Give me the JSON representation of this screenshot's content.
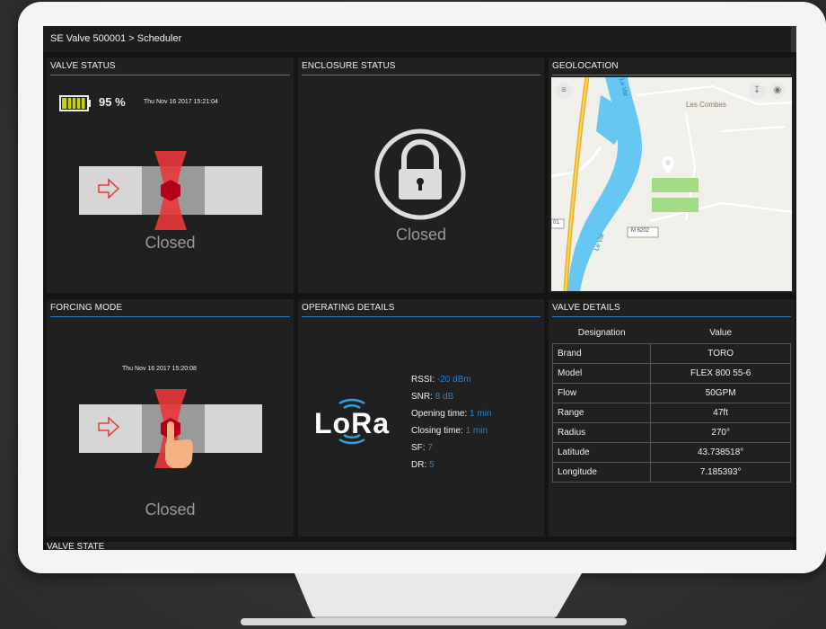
{
  "breadcrumb": "SE Valve 500001 > Scheduler",
  "valve_status": {
    "title": "VALVE STATUS",
    "battery_percent": "95 %",
    "battery_level": 0.95,
    "timestamp": "Thu Nov 16 2017 15:21:04",
    "state": "Closed"
  },
  "enclosure_status": {
    "title": "ENCLOSURE STATUS",
    "state": "Closed"
  },
  "geolocation": {
    "title": "GEOLOCATION",
    "place_label": "Les Combes",
    "river_label": "Le Var",
    "road_label": "M 6202",
    "road_label2": "01"
  },
  "forcing_mode": {
    "title": "FORCING MODE",
    "timestamp": "Thu Nov 16 2017 15:20:08",
    "state": "Closed"
  },
  "operating_details": {
    "title": "OPERATING DETAILS",
    "logo_text": "LoRa",
    "rssi_label": "RSSI:",
    "rssi_value": "-20 dBm",
    "snr_label": "SNR:",
    "snr_value": "8 dB",
    "opening_label": "Opening time:",
    "opening_value": "1 min",
    "closing_label": "Closing time:",
    "closing_value": "1 min",
    "sf_label": "SF:",
    "sf_value": "7",
    "dr_label": "DR:",
    "dr_value": "5"
  },
  "valve_details": {
    "title": "VALVE DETAILS",
    "col_designation": "Designation",
    "col_value": "Value",
    "rows": [
      {
        "name": "Brand",
        "value": "TORO"
      },
      {
        "name": "Model",
        "value": "FLEX 800 55-6"
      },
      {
        "name": "Flow",
        "value": "50GPM"
      },
      {
        "name": "Range",
        "value": "47ft"
      },
      {
        "name": "Radius",
        "value": "270°"
      },
      {
        "name": "Latitude",
        "value": "43.738518°"
      },
      {
        "name": "Longitude",
        "value": "7.185393°"
      }
    ]
  },
  "valve_state": {
    "title": "VALVE STATE"
  },
  "colors": {
    "accent": "#2f7fc4",
    "valve_red": "#e8393a",
    "panel": "#202020",
    "battery": "#c8d400"
  },
  "icons": [
    "battery-icon",
    "arrow-right-icon",
    "padlock-icon",
    "hamburger-menu-icon",
    "download-icon",
    "eye-icon",
    "map-pin-icon",
    "hand-pointer-icon",
    "lora-signal-icon"
  ]
}
